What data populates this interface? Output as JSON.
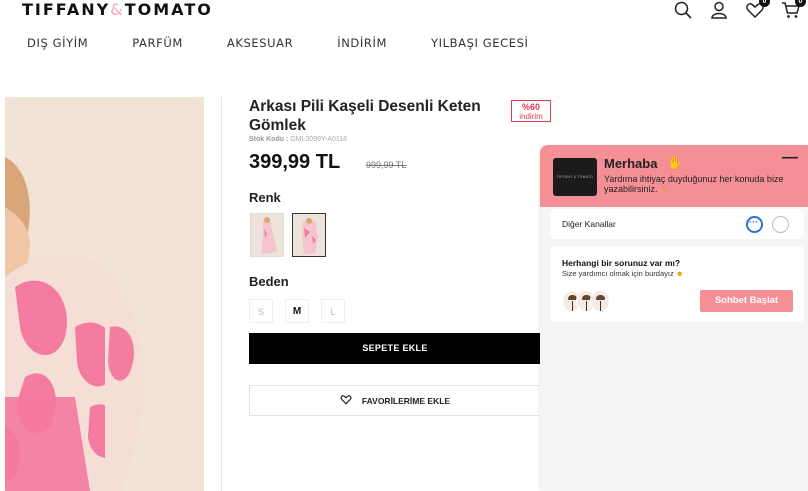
{
  "brand": {
    "logo_left": "TIFFANY",
    "logo_amp": "&",
    "logo_right": "TOMATO"
  },
  "header": {
    "icons": [
      {
        "name": "search-icon",
        "count": null
      },
      {
        "name": "user-icon",
        "count": null
      },
      {
        "name": "heart-icon",
        "count": "0"
      },
      {
        "name": "cart-icon",
        "count": "0"
      }
    ],
    "wishlist_count": "0",
    "cart_count": "0"
  },
  "nav": {
    "items": [
      "DIŞ GİYİM",
      "PARFÜM",
      "AKSESUAR",
      "İNDİRİM",
      "YILBAŞI GECESİ"
    ]
  },
  "product": {
    "title": "Arkası Pili Kaşeli Desenli Keten Gömlek",
    "discount_value": "%60",
    "discount_label": "indirim",
    "sku_label": "Stok Kodu :",
    "sku_value": "GML0099Y-A0118",
    "price": "399,99 TL",
    "old_price": "999,99 TL",
    "color_label": "Renk",
    "size_label": "Beden",
    "sizes": [
      {
        "label": "S",
        "available": false,
        "selected": false
      },
      {
        "label": "M",
        "available": true,
        "selected": true
      },
      {
        "label": "L",
        "available": false,
        "selected": false
      }
    ],
    "add_to_cart": "SEPETE EKLE",
    "add_to_favorites": "FAVORİLERİME EKLE"
  },
  "chat": {
    "title": "Merhaba",
    "subtitle": "Yardıma ihtiyaç duyduğunuz her konuda bize yazabilirsiniz.",
    "avatar_text": "TIFFANY & TOMATO",
    "other_channels": "Diğer Kanallar",
    "question": "Herhangi bir sorunuz var mı?",
    "answer": "Size yardımcı olmak için burdayız",
    "start_button": "Sohbet Başlat"
  },
  "colors": {
    "accent_pink": "#f58f96",
    "discount_red": "#e43b4f",
    "cart_button": "#000000"
  }
}
